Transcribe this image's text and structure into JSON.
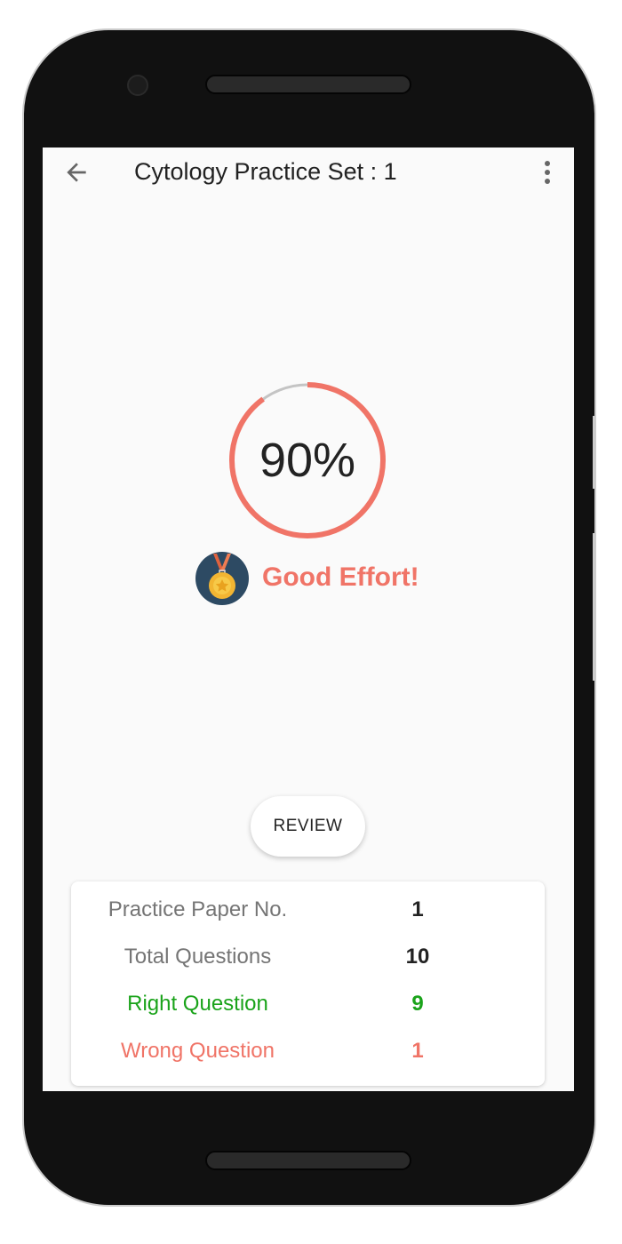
{
  "toolbar": {
    "title": "Cytology Practice Set : 1",
    "back_icon": "arrow-left-icon",
    "menu_icon": "more-vertical-icon"
  },
  "result": {
    "percent_label": "90%",
    "progress_fraction": 0.9,
    "message": "Good Effort!",
    "medal_icon": "medal-icon",
    "progress_color": "#f07467",
    "track_color": "#c4c4c4"
  },
  "review_label": "REVIEW",
  "summary": [
    {
      "label": "Practice Paper No.",
      "value": "1",
      "color": "#757575",
      "value_color": "#222222"
    },
    {
      "label": "Total Questions",
      "value": "10",
      "color": "#757575",
      "value_color": "#222222"
    },
    {
      "label": "Right Question",
      "value": "9",
      "color": "#1aa31a",
      "value_color": "#1aa31a"
    },
    {
      "label": "Wrong Question",
      "value": "1",
      "color": "#f07467",
      "value_color": "#f07467"
    }
  ]
}
